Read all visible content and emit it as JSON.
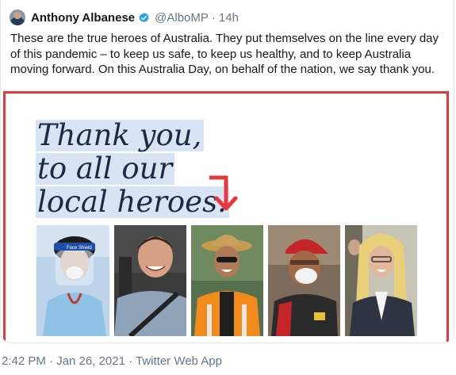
{
  "tweet": {
    "author_name": "Anthony Albanese",
    "handle": "@AlboMP",
    "separator": "·",
    "time_ago": "14h",
    "text": "These are the true heroes of Australia. They put themselves on the line every day of this pandemic – to keep us safe, to keep us healthy, and to keep Australia moving forward. On this Australia Day, on behalf of the nation, we say thank you.",
    "verified_icon": "verified-badge-icon",
    "accent_color": "#1da1f2"
  },
  "media": {
    "headline_lines": [
      "Thank you,",
      "to all our",
      "local heroes."
    ],
    "arrow_icon": "arrow-down-right-icon",
    "frame_color": "#e4393c",
    "headline_color": "#1d2a44",
    "highlight_color": "#d8e3f4",
    "photos": [
      {
        "name": "healthcare-worker-photo",
        "cap_text": "Face Shield"
      },
      {
        "name": "truck-driver-photo",
        "cap_text": ""
      },
      {
        "name": "road-worker-photo",
        "cap_text": ""
      },
      {
        "name": "delivery-worker-photo",
        "cap_text": ""
      },
      {
        "name": "retail-worker-photo",
        "cap_text": ""
      }
    ]
  },
  "footer": {
    "text": "2:42 PM · Jan 26, 2021 · Twitter Web App"
  }
}
